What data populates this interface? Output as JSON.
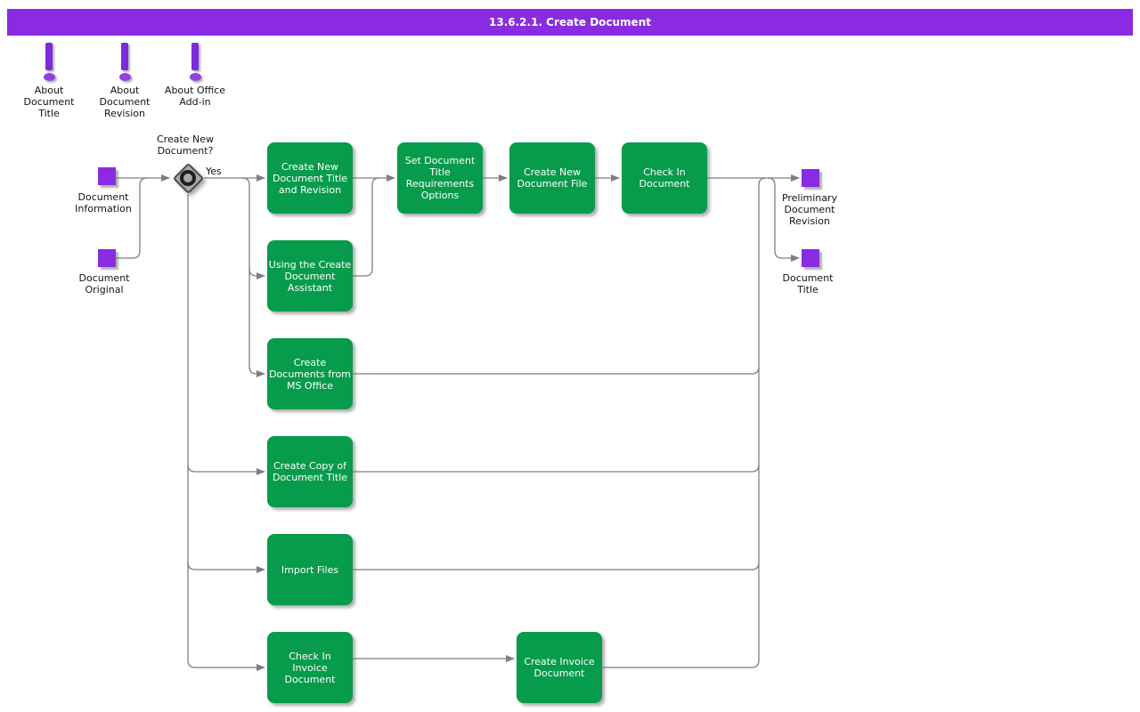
{
  "title_bar": {
    "text": "13.6.2.1. Create Document"
  },
  "colors": {
    "accent_purple": "#8A2BE2",
    "task_green": "#079B4C",
    "connector_gray": "#7F7F7F",
    "decision_gray": "#A9A9A9"
  },
  "about_icons": [
    {
      "label": "About\nDocument\nTitle"
    },
    {
      "label": "About\nDocument\nRevision"
    },
    {
      "label": "About Office\nAdd-in"
    }
  ],
  "decision": {
    "question": "Create New\nDocument?",
    "yes_label": "Yes"
  },
  "data_objects": {
    "document_information": "Document\nInformation",
    "document_original": "Document\nOriginal",
    "preliminary_document_revision": "Preliminary\nDocument\nRevision",
    "document_title": "Document\nTitle"
  },
  "tasks": {
    "create_new_document_title_and_revision": "Create New\nDocument Title\nand Revision",
    "set_document_title_requirements_options": "Set Document\nTitle\nRequirements\nOptions",
    "create_new_document_file": "Create New\nDocument File",
    "check_in_document": "Check In\nDocument",
    "using_the_create_document_assistant": "Using the Create\nDocument\nAssistant",
    "create_documents_from_ms_office": "Create\nDocuments from\nMS Office",
    "create_copy_of_document_title": "Create Copy of\nDocument Title",
    "import_files": "Import Files",
    "check_in_invoice_document": "Check In\nInvoice\nDocument",
    "create_invoice_document": "Create Invoice\nDocument"
  }
}
